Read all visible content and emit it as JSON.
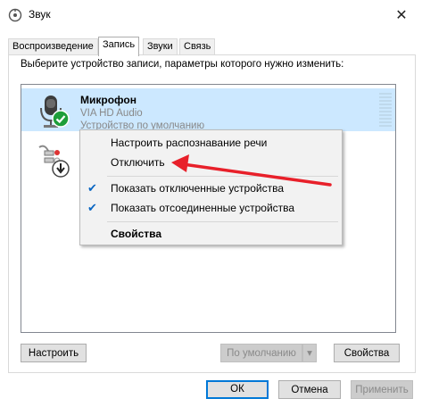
{
  "window": {
    "title": "Звук",
    "close_glyph": "✕"
  },
  "tabs": [
    {
      "label": "Воспроизведение",
      "active": false
    },
    {
      "label": "Запись",
      "active": true
    },
    {
      "label": "Звуки",
      "active": false
    },
    {
      "label": "Связь",
      "active": false
    }
  ],
  "instruction": "Выберите устройство записи, параметры которого нужно изменить:",
  "devices": [
    {
      "name": "Микрофон",
      "driver": "VIA HD Audio",
      "status": "Устройство по умолчанию",
      "icon": "microphone-icon",
      "badge": "default-check-icon",
      "selected": true
    },
    {
      "icon": "line-in-icon",
      "badge": "disabled-arrow-icon"
    }
  ],
  "context_menu": {
    "items": [
      {
        "label": "Настроить распознавание речи",
        "checked": false,
        "bold": false
      },
      {
        "label": "Отключить",
        "checked": false,
        "bold": false
      },
      {
        "label": "Показать отключенные устройства",
        "checked": true,
        "bold": false
      },
      {
        "label": "Показать отсоединенные устройства",
        "checked": true,
        "bold": false
      },
      {
        "label": "Свойства",
        "checked": false,
        "bold": true
      }
    ],
    "check_glyph": "✔"
  },
  "buttons": {
    "configure": "Настроить",
    "set_default": "По умолчанию",
    "properties": "Свойства",
    "ok": "ОК",
    "cancel": "Отмена",
    "apply": "Применить"
  },
  "colors": {
    "selection": "#cce8ff",
    "accent": "#0078d7",
    "arrow": "#e8202a",
    "check": "#1e9e3a"
  }
}
